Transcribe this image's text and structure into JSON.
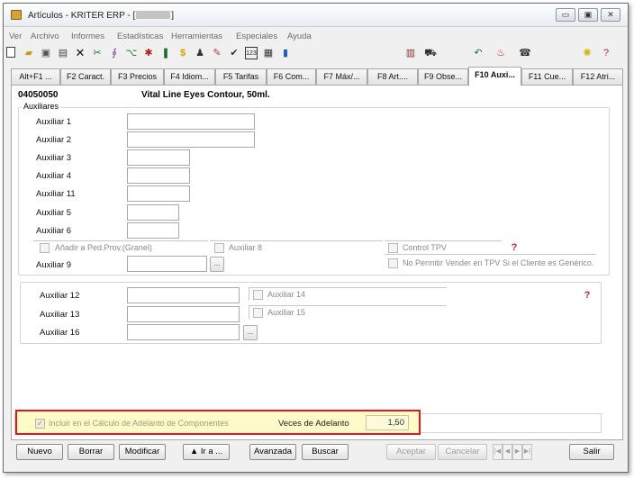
{
  "window": {
    "title": "Artículos - KRITER ERP - [",
    "title_suffix": "]",
    "minimize": "▭",
    "maximize": "▣",
    "close": "✕"
  },
  "menu": [
    "Ver",
    "Archivo",
    "Informes",
    "Estadísticas",
    "Herramientas",
    "Especiales",
    "Ayuda"
  ],
  "toolbar_icons": [
    "new-document-icon",
    "open-folder-icon",
    "save-disk-icon",
    "edit-form-icon",
    "delete-x-icon",
    "tools-icon",
    "link-icon",
    "hierarchy-icon",
    "asterisk-icon",
    "bottles-icon",
    "dollar-icon",
    "stamp-icon",
    "brush-icon",
    "checklist-icon",
    "keypad-123-icon",
    "printer-icon",
    "bar-chart-icon",
    "calculator-icon",
    "shopping-cart-icon",
    "undo-arrow-icon",
    "money-bag-icon",
    "phone-icon",
    "lightbulb-icon",
    "help-hat-icon"
  ],
  "tabs": [
    "Alt+F1 ...",
    "F2 Caract.",
    "F3 Precios",
    "F4 Idiom...",
    "F5 Tarifas",
    "F6 Com...",
    "F7 Máx/...",
    "F8 Art....",
    "F9 Obse...",
    "F10 Auxi...",
    "F11 Cue...",
    "F12 Atri..."
  ],
  "article": {
    "code": "04050050",
    "description": "Vital Line Eyes Contour, 50ml."
  },
  "group_title": "Auxiliares",
  "fields": [
    {
      "label": "Auxiliar 1",
      "value": ""
    },
    {
      "label": "Auxiliar 2",
      "value": ""
    },
    {
      "label": "Auxiliar 3",
      "value": ""
    },
    {
      "label": "Auxiliar 4",
      "value": ""
    },
    {
      "label": "Auxiliar 11",
      "value": ""
    },
    {
      "label": "Auxiliar 5",
      "value": ""
    },
    {
      "label": "Auxiliar 6",
      "value": ""
    },
    {
      "label": "Auxiliar 9",
      "value": ""
    }
  ],
  "checks_top": {
    "anadir": "Añadir a Ped.Prov.(Granel)",
    "auxiliar8": "Auxiliar 8",
    "control_tpv": "Control TPV",
    "no_permitir": "No Permitir Vender en TPV Si el Cliente es Genérico."
  },
  "fields2": [
    {
      "label": "Auxiliar 12",
      "value": ""
    },
    {
      "label": "Auxiliar 13",
      "value": ""
    },
    {
      "label": "Auxiliar 16",
      "value": ""
    }
  ],
  "checks2": {
    "auxiliar14": "Auxiliar 14",
    "auxiliar15": "Auxiliar 15"
  },
  "ellipsis": "...",
  "adelanto": {
    "checkbox_label": "Incluir en el Cálculo de Adelanto de Componentes",
    "checked_mark": "✓",
    "veces_label": "Veces de Adelanto",
    "veces_value": "1,50"
  },
  "buttons": {
    "nuevo": "Nuevo",
    "borrar": "Borrar",
    "modificar": "Modificar",
    "ir_a": "▲ Ir a ...",
    "avanzada": "Avanzada",
    "buscar": "Buscar",
    "aceptar": "Aceptar",
    "cancelar": "Cancelar",
    "salir": "Salir"
  },
  "nav": [
    "|◀",
    "◀",
    "▶",
    "▶|"
  ]
}
